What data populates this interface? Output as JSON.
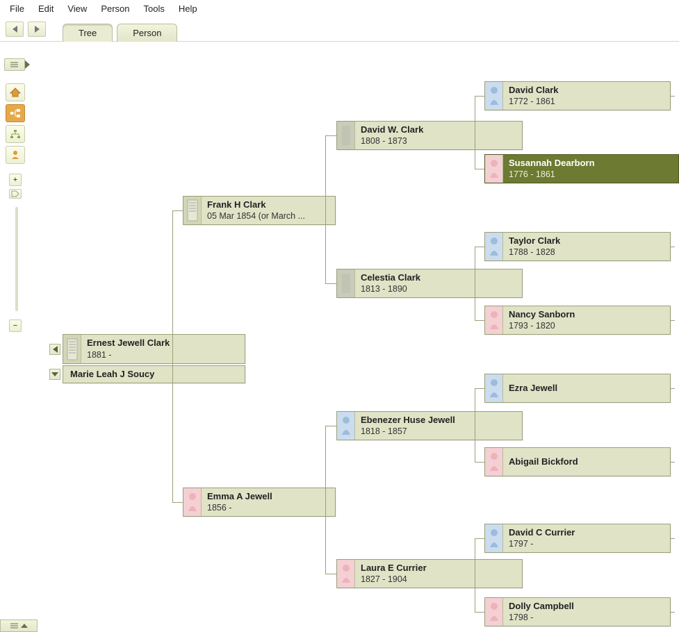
{
  "menu": {
    "items": [
      "File",
      "Edit",
      "View",
      "Person",
      "Tools",
      "Help"
    ]
  },
  "tabs": {
    "tree": "Tree",
    "person": "Person",
    "active": "tree"
  },
  "tools": {
    "home": "home-icon",
    "pedigree": "pedigree-icon",
    "descendant": "descendant-icon",
    "person": "person-icon",
    "plus": "+",
    "minus": "−",
    "slider_pos": 0
  },
  "tree": {
    "root": {
      "name": "Ernest Jewell Clark",
      "dates": "1881 -",
      "thumb": "doc"
    },
    "spouse": {
      "name": "Marie Leah J Soucy",
      "dates": "",
      "thumb": "none"
    },
    "father": {
      "name": "Frank H Clark",
      "dates": "05 Mar 1854 (or March ...",
      "thumb": "doc",
      "father": {
        "name": "David W. Clark",
        "dates": "1808 - 1873",
        "thumb": "gray",
        "father": {
          "name": "David Clark",
          "dates": "1772 - 1861",
          "thumb": "male"
        },
        "mother": {
          "name": "Susannah Dearborn",
          "dates": "1776 - 1861",
          "thumb": "female",
          "selected": true
        }
      },
      "mother": {
        "name": "Celestia Clark",
        "dates": "1813 - 1890",
        "thumb": "gray",
        "father": {
          "name": "Taylor Clark",
          "dates": "1788 - 1828",
          "thumb": "male"
        },
        "mother": {
          "name": "Nancy Sanborn",
          "dates": "1793 - 1820",
          "thumb": "female"
        }
      }
    },
    "mother": {
      "name": "Emma A Jewell",
      "dates": "1856 -",
      "thumb": "female",
      "father": {
        "name": "Ebenezer Huse Jewell",
        "dates": "1818 - 1857",
        "thumb": "male",
        "father": {
          "name": "Ezra Jewell",
          "dates": "",
          "thumb": "male"
        },
        "mother": {
          "name": "Abigail Bickford",
          "dates": "",
          "thumb": "female"
        }
      },
      "mother": {
        "name": "Laura E Currier",
        "dates": "1827 - 1904",
        "thumb": "female",
        "father": {
          "name": "David C Currier",
          "dates": "1797 -",
          "thumb": "male"
        },
        "mother": {
          "name": "Dolly Campbell",
          "dates": "1798 -",
          "thumb": "female"
        }
      }
    }
  }
}
